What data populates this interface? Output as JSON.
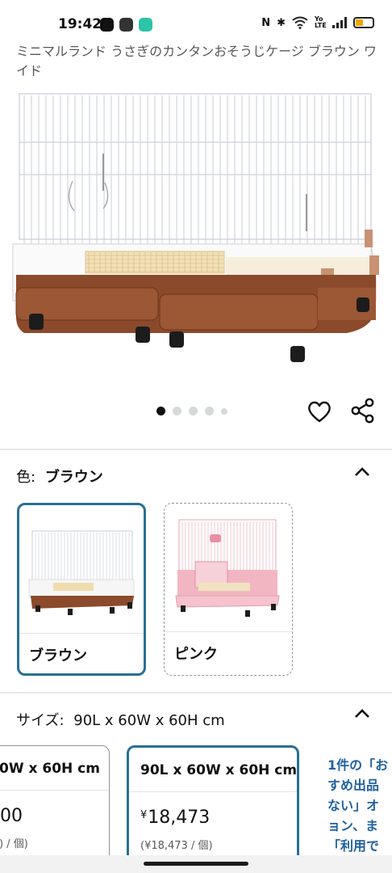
{
  "status_bar": {
    "time": "19:42",
    "network_label": "Yo LTE",
    "battery_level": 0.45
  },
  "product": {
    "title": "ミニマルランド うさぎのカンタンおそうじケージ ブラウン ワイド",
    "image_count": 5,
    "active_image_index": 0
  },
  "color_section": {
    "label": "色:",
    "selected_value": "ブラウン",
    "options": [
      {
        "label": "ブラウン",
        "selected": true,
        "accent": "#8b4a2b"
      },
      {
        "label": "ピンク",
        "selected": false,
        "accent": "#f2b6c2"
      }
    ]
  },
  "size_section": {
    "label": "サイズ:",
    "selected_value": "90L x 60W x 60H cm",
    "options": [
      {
        "title": "0W x 60H cm",
        "price_symbol": "",
        "price": "00",
        "unit_price": ") / 個)",
        "selected": false
      },
      {
        "title": "90L x 60W x 60H cm",
        "price_symbol": "¥",
        "price": "18,473",
        "unit_price": "(¥18,473 / 個)",
        "selected": true
      }
    ]
  },
  "side_note": {
    "lines": [
      "1件の「お",
      "すめ出品",
      "ない」オ",
      "ョン、ま",
      "「利用で"
    ]
  },
  "colors": {
    "selected_border": "#2a6f95",
    "link": "#2162a1",
    "cage_tray_brown": "#8b4a2b",
    "cage_pink": "#f2b6c2"
  }
}
